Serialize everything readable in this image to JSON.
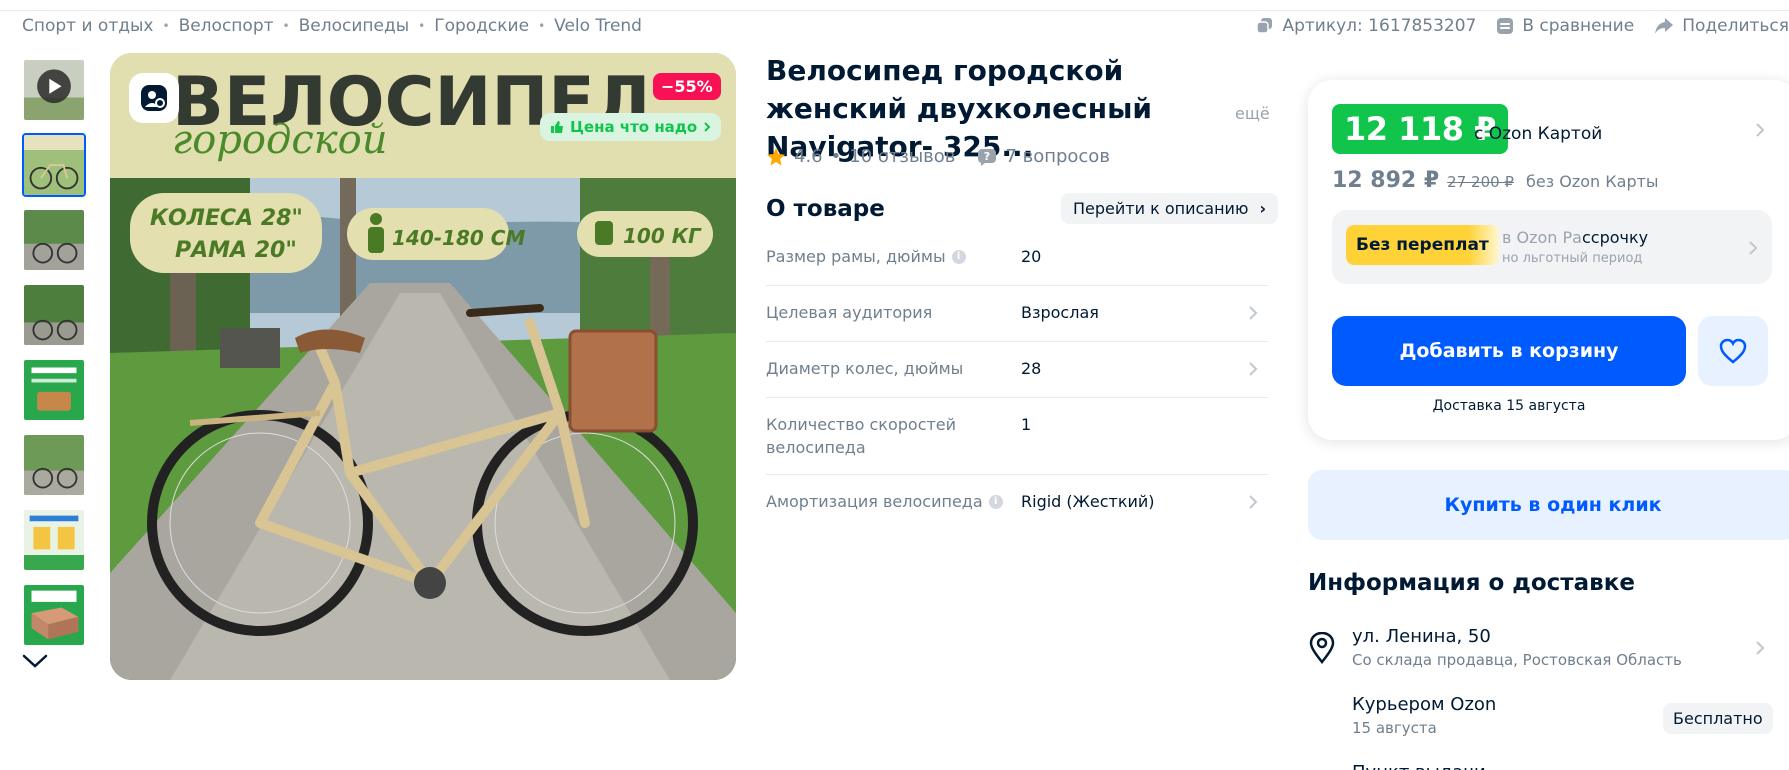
{
  "breadcrumb": [
    "Спорт и отдых",
    "Велоспорт",
    "Велосипеды",
    "Городские",
    "Velo Trend"
  ],
  "top_actions": {
    "article": "Артикул: 1617853207",
    "compare": "В сравнение",
    "share": "Поделиться"
  },
  "gallery": {
    "banner_title": "ВЕЛОСИПЕД",
    "banner_subtitle": "городской",
    "discount": "−55%",
    "price_tag": "Цена что надо",
    "wheels_label_1": "КОЛЕСА 28\"",
    "wheels_label_2": "РАМА 20\"",
    "height_label": "140-180 СМ",
    "weight_label": "100 КГ"
  },
  "product": {
    "title": "Велосипед городской женский двухколесный Navigator- 325...",
    "title_more": "ещё",
    "rating": "4.6",
    "reviews": "10 отзывов",
    "questions": "7 вопросов"
  },
  "about": {
    "heading": "О товаре",
    "goto_desc": "Перейти к описанию",
    "specs": [
      {
        "name": "Размер рамы, дюймы",
        "value": "20"
      },
      {
        "name": "Целевая аудитория",
        "value": "Взрослая"
      },
      {
        "name": "Диаметр колес, дюймы",
        "value": "28"
      },
      {
        "name": "Количество скоростей велосипеда",
        "value": "1"
      },
      {
        "name": "Амортизация велосипеда",
        "value": "Rigid (Жесткий)"
      }
    ]
  },
  "buy": {
    "ozon_price": "12 118 ₽",
    "ozon_price_label": "с Ozon Картой",
    "price": "12 892 ₽",
    "old_price": "27 200 ₽",
    "price_label": "без Ozon Карты",
    "installment_badge": "Без переплат",
    "installment_line1_a": "в Ozon Ра",
    "installment_line1_b": "ссрочку",
    "installment_line2": "но льготный период",
    "add_to_cart": "Добавить в корзину",
    "delivery_date": "Доставка 15 августа",
    "one_click": "Купить в один клик"
  },
  "delivery": {
    "title": "Информация о доставке",
    "address": "ул. Ленина, 50",
    "address_sub": "Со склада продавца, Ростовская Область",
    "courier": "Курьером Ozon",
    "courier_date": "15 августа",
    "courier_price": "Бесплатно",
    "next_item": "Пункт выдачи"
  },
  "colors": {
    "ozon_blue": "#005bff",
    "ozon_green": "#10c44c",
    "discount_red": "#f91155",
    "installment_yellow": "#ffd338"
  }
}
